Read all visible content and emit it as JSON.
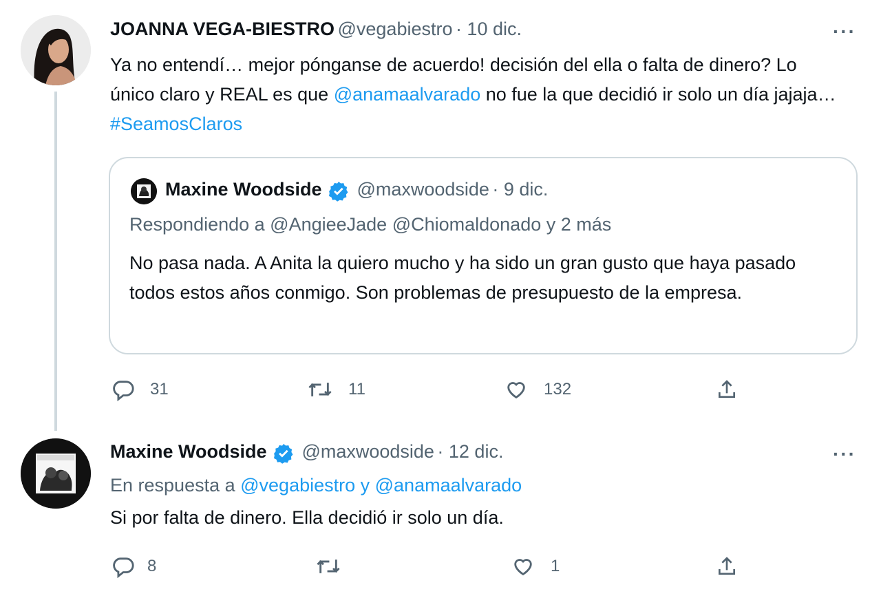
{
  "tweet1": {
    "name": "JOANNA VEGA-BIESTRO",
    "handle": "@vegabiestro",
    "date": "· 10 dic.",
    "more": "···",
    "text_1": "Ya no entendí… mejor pónganse de acuerdo! decisión del ella o falta de dinero? Lo único claro y REAL es que ",
    "mention": "@anamaalvarado",
    "text_2": " no fue la que decidió ir solo un día jajaja… ",
    "hashtag": "#SeamosClaros",
    "quote": {
      "name": "Maxine Woodside",
      "handle": "@maxwoodside",
      "date": "· 9 dic.",
      "replying": "Respondiendo a @AngieeJade @Chiomaldonado y 2 más",
      "text": "No pasa nada. A Anita la quiero mucho y ha sido un gran gusto que haya pasado todos estos años conmigo. Son problemas de presupuesto de la empresa."
    },
    "replies": "31",
    "retweets": "11",
    "likes": "132"
  },
  "tweet2": {
    "name": "Maxine Woodside",
    "handle": "@maxwoodside",
    "date": "· 12 dic.",
    "more": "···",
    "reply_prefix": "En respuesta a ",
    "reply_to": "@vegabiestro y @anamaalvarado",
    "text": "Si por falta de dinero. Ella decidió ir solo un día.",
    "replies": "8",
    "likes": "1"
  },
  "colors": {
    "link": "#1d9bf0",
    "secondary_text": "#536471",
    "border": "#cfd9de",
    "verified": "#1d9bf0"
  },
  "icons": [
    "reply-icon",
    "retweet-icon",
    "like-icon",
    "share-icon",
    "verified-badge-icon",
    "more-options-icon"
  ]
}
